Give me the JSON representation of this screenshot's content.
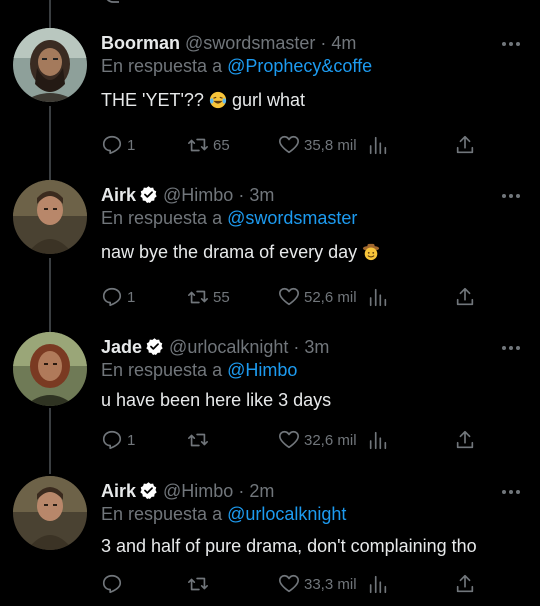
{
  "tweets": [
    {
      "name": "Boorman",
      "verified": false,
      "handle": "@swordsmaster",
      "separator": "·",
      "time": "4m",
      "reply_prefix": "En respuesta a",
      "reply_mention": "@Prophecy&coffe",
      "text": "THE 'YET'??",
      "text_after_emoji": " gurl what",
      "emoji": "crying-laughing-face",
      "replies": "1",
      "retweets": "65",
      "likes": "35,8 mil"
    },
    {
      "name": "Airk",
      "verified": true,
      "handle": "@Himbo",
      "separator": "·",
      "time": "3m",
      "reply_prefix": "En respuesta a",
      "reply_mention": "@swordsmaster",
      "text": "naw bye the drama of every day ",
      "emoji": "cowboy-face",
      "replies": "1",
      "retweets": "55",
      "likes": "52,6 mil"
    },
    {
      "name": "Jade",
      "verified": true,
      "handle": "@urlocalknight",
      "separator": "·",
      "time": "3m",
      "reply_prefix": "En respuesta a",
      "reply_mention": "@Himbo",
      "text": "u have been here like 3 days",
      "replies": "1",
      "retweets": "",
      "likes": "32,6 mil"
    },
    {
      "name": "Airk",
      "verified": true,
      "handle": "@Himbo",
      "separator": "·",
      "time": "2m",
      "reply_prefix": "En respuesta a",
      "reply_mention": "@urlocalknight",
      "text": "3 and half of pure drama, don't complaining tho",
      "replies": "",
      "retweets": "",
      "likes": "33,3 mil"
    }
  ],
  "colors": {
    "background": "#000000",
    "text": "#e7e9ea",
    "secondary": "#71767b",
    "mention": "#1d9bf0",
    "verified": "#ffffff",
    "thread_line": "#3a3e41"
  }
}
